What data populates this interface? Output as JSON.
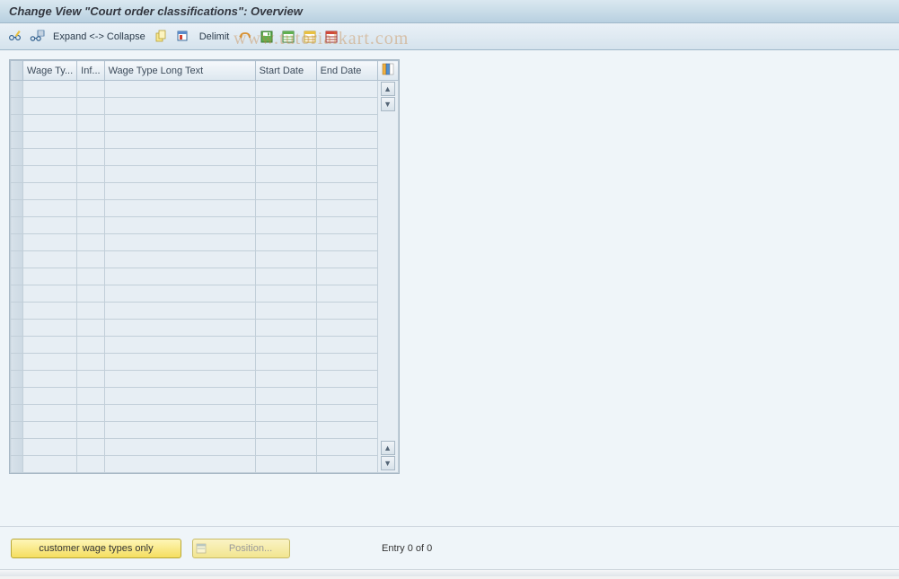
{
  "title": "Change View \"Court order classifications\": Overview",
  "toolbar": {
    "expand_label": "Expand <-> Collapse",
    "delimit_label": "Delimit"
  },
  "table": {
    "columns": {
      "wage_type": "Wage Ty...",
      "inf": "Inf...",
      "long_text": "Wage Type Long Text",
      "start_date": "Start Date",
      "end_date": "End Date"
    },
    "rows": 23
  },
  "footer": {
    "customer_wage_btn": "customer wage types only",
    "position_btn": "Position...",
    "entry_text": "Entry 0 of 0"
  },
  "watermark": "www.tutorialkart.com"
}
